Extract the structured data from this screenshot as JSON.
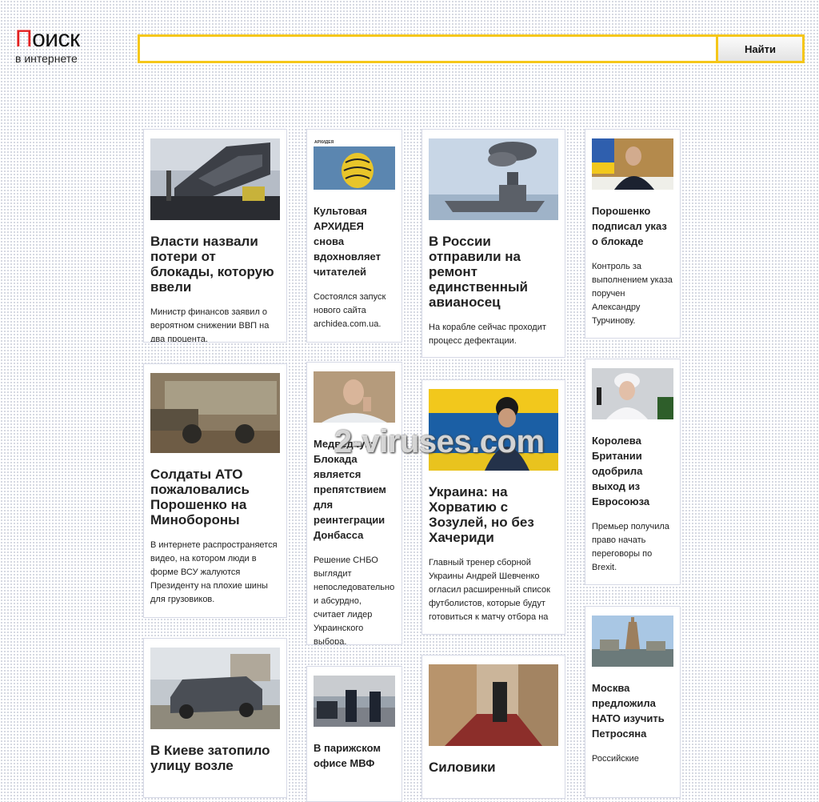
{
  "header": {
    "logo_first": "П",
    "logo_rest": "оиск",
    "logo_sub": "в интернете",
    "search_value": "",
    "search_button": "Найти"
  },
  "cards": [
    {
      "title": "Власти назвали потери от блокады, которую ввели",
      "desc": "Министр финансов заявил о вероятном снижении ВВП на два процента."
    },
    {
      "title": "Культовая АРХИДЕЯ снова вдохновляет читателей",
      "desc": "Состоялся запуск нового сайта archidea.com.ua.",
      "img_caption": "АРХИДЕЯ"
    },
    {
      "title": "В России отправили на ремонт единственный авианосец",
      "desc": "На корабле сейчас проходит процесс дефектации."
    },
    {
      "title": "Порошенко подписал указ о блокаде",
      "desc": "Контроль за выполнением указа поручен Александру Турчинову."
    },
    {
      "title": "Солдаты АТО пожаловались Порошенко на Минобороны",
      "desc": "В интернете распространяется видео, на котором люди в форме ВСУ жалуются Президенту на плохие шины для грузовиков."
    },
    {
      "title": "Медведчук: Блокада является препятствием для реинтеграции Донбасса",
      "desc": "Решение СНБО выглядит непоследовательно и абсурдно, считает лидер Украинского выбора."
    },
    {
      "title": "Украина: на Хорватию с Зозулей, но без Хачериди",
      "desc": "Главный тренер сборной Украины Андрей Шевченко огласил расширенный список футболистов, которые будут готовиться к матчу отбора на"
    },
    {
      "title": "Королева Британии одобрила выход из Евросоюза",
      "desc": "Премьер получила право начать переговоры по Brexit."
    },
    {
      "title": "В Киеве затопило улицу возле",
      "desc": ""
    },
    {
      "title": "В парижском офисе МВФ",
      "desc": ""
    },
    {
      "title": "Силовики",
      "desc": ""
    },
    {
      "title": "Москва предложила НАТО изучить Петросяна",
      "desc": "Российские"
    }
  ],
  "watermark": "2-viruses.com"
}
